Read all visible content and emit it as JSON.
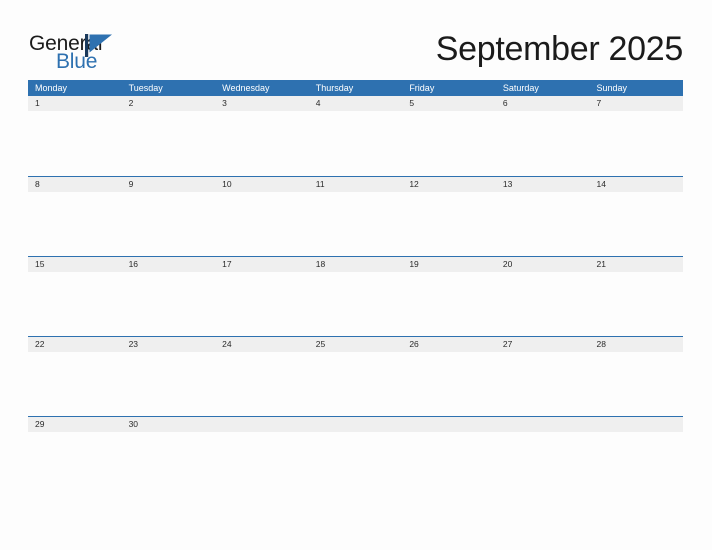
{
  "brand": {
    "name_part1": "General",
    "name_part2": "Blue",
    "mark_icon": "triangle-flag-icon",
    "accent_color": "#2e71b0",
    "text_color": "#1b1b1b"
  },
  "header": {
    "title": "September 2025",
    "month": "September",
    "year": "2025"
  },
  "calendar": {
    "header_background": "#2e71b0",
    "header_text_color": "#ffffff",
    "date_strip_background": "#efefef",
    "row_border_color": "#2e71b0",
    "page_background": "#fdfdfd",
    "weekdays": [
      {
        "label": "Monday"
      },
      {
        "label": "Tuesday"
      },
      {
        "label": "Wednesday"
      },
      {
        "label": "Thursday"
      },
      {
        "label": "Friday"
      },
      {
        "label": "Saturday"
      },
      {
        "label": "Sunday"
      }
    ],
    "weeks": [
      {
        "days": [
          {
            "date": "1"
          },
          {
            "date": "2"
          },
          {
            "date": "3"
          },
          {
            "date": "4"
          },
          {
            "date": "5"
          },
          {
            "date": "6"
          },
          {
            "date": "7"
          }
        ]
      },
      {
        "days": [
          {
            "date": "8"
          },
          {
            "date": "9"
          },
          {
            "date": "10"
          },
          {
            "date": "11"
          },
          {
            "date": "12"
          },
          {
            "date": "13"
          },
          {
            "date": "14"
          }
        ]
      },
      {
        "days": [
          {
            "date": "15"
          },
          {
            "date": "16"
          },
          {
            "date": "17"
          },
          {
            "date": "18"
          },
          {
            "date": "19"
          },
          {
            "date": "20"
          },
          {
            "date": "21"
          }
        ]
      },
      {
        "days": [
          {
            "date": "22"
          },
          {
            "date": "23"
          },
          {
            "date": "24"
          },
          {
            "date": "25"
          },
          {
            "date": "26"
          },
          {
            "date": "27"
          },
          {
            "date": "28"
          }
        ]
      },
      {
        "days": [
          {
            "date": "29"
          },
          {
            "date": "30"
          },
          {
            "date": ""
          },
          {
            "date": ""
          },
          {
            "date": ""
          },
          {
            "date": ""
          },
          {
            "date": ""
          }
        ]
      }
    ]
  }
}
